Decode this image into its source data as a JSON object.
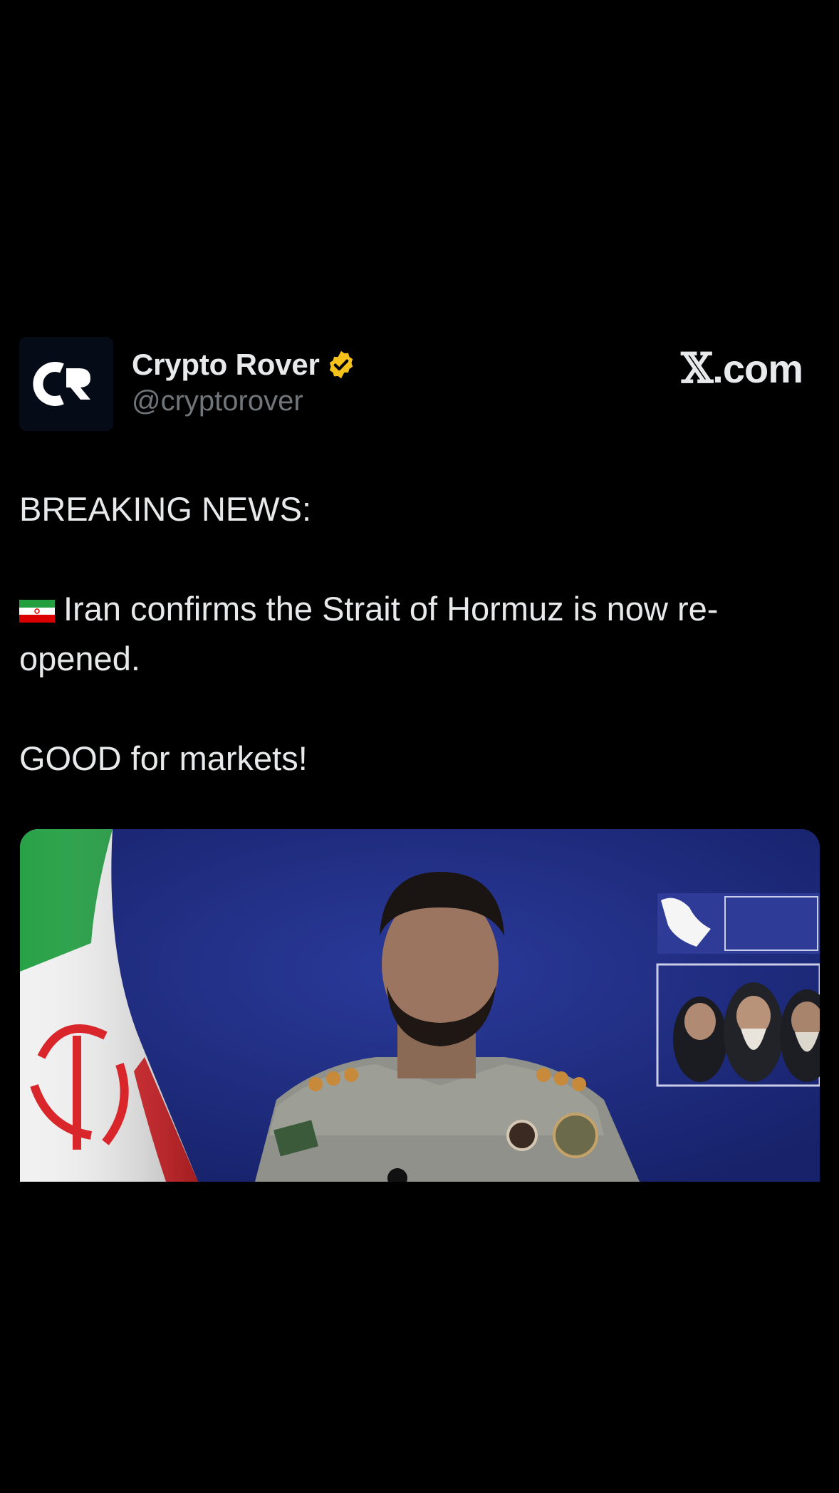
{
  "post": {
    "author": {
      "display_name": "Crypto Rover",
      "handle": "@cryptorover",
      "avatar_icon": "cr-logo-avatar",
      "verified_icon": "gold-verified-badge-icon",
      "verified_color": "#f4c21b"
    },
    "brand": {
      "glyph": "𝕏",
      "suffix": ".com"
    },
    "text": {
      "line1": "BREAKING NEWS:",
      "flag_icon": "iran-flag-icon",
      "line2": "Iran confirms the Strait of Hormuz is now re-opened.",
      "line3": "GOOD for markets!"
    },
    "media": {
      "type": "video-thumbnail"
    }
  },
  "colors": {
    "background": "#000000",
    "text_primary": "#e7e9ea",
    "text_secondary": "#71767b",
    "media_backdrop": "#1d2a7a"
  }
}
